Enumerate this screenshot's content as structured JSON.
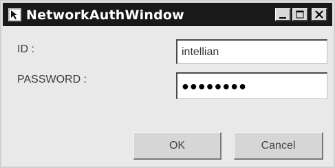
{
  "window": {
    "title": "NetworkAuthWindow",
    "icon": "app-icon",
    "controls": [
      "minimize-icon",
      "maximize-icon",
      "close-icon"
    ]
  },
  "form": {
    "id_label": "ID :",
    "id_value": "intellian",
    "password_label": "PASSWORD :",
    "password_value": "●●●●●●●●"
  },
  "buttons": {
    "ok": "OK",
    "cancel": "Cancel"
  }
}
